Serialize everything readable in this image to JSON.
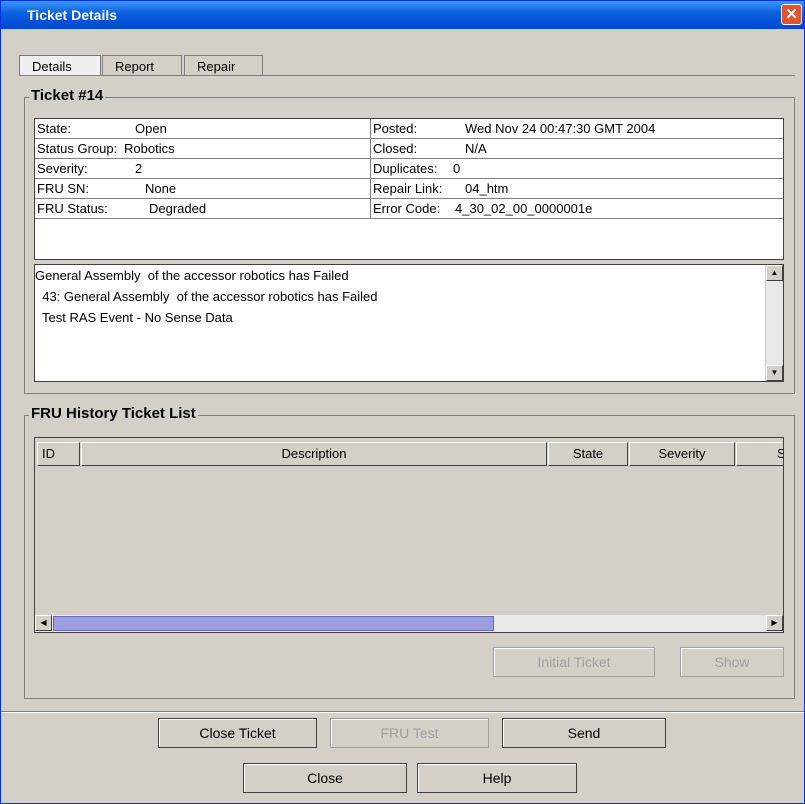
{
  "window": {
    "title": "Ticket Details",
    "close_icon": "close-icon"
  },
  "tabs": [
    {
      "label": "Details"
    },
    {
      "label": "Report"
    },
    {
      "label": "Repair"
    }
  ],
  "ticket": {
    "group_title": "Ticket #14",
    "fields_left": [
      {
        "label": "State:",
        "value": "Open"
      },
      {
        "label": "Status Group:",
        "value": "Robotics"
      },
      {
        "label": "Severity:",
        "value": "2"
      },
      {
        "label": "FRU SN:",
        "value": "None"
      },
      {
        "label": "FRU Status:",
        "value": "Degraded"
      }
    ],
    "fields_right": [
      {
        "label": "Posted:",
        "value": "Wed Nov 24 00:47:30 GMT 2004"
      },
      {
        "label": "Closed:",
        "value": "N/A"
      },
      {
        "label": "Duplicates:",
        "value": "0"
      },
      {
        "label": "Repair Link:",
        "value": "04_htm"
      },
      {
        "label": "Error Code:",
        "value": "4_30_02_00_0000001e"
      }
    ],
    "description_lines": [
      "General Assembly  of the accessor robotics has Failed",
      "  43: General Assembly  of the accessor robotics has Failed",
      "  Test RAS Event - No Sense Data"
    ]
  },
  "history": {
    "group_title": "FRU History Ticket List",
    "columns": [
      "ID",
      "Description",
      "State",
      "Severity",
      "S"
    ],
    "rows": [],
    "initial_ticket_label": "Initial Ticket",
    "show_label": "Show"
  },
  "footer": {
    "close_ticket_label": "Close Ticket",
    "fru_test_label": "FRU Test",
    "send_label": "Send",
    "close_label": "Close",
    "help_label": "Help"
  }
}
